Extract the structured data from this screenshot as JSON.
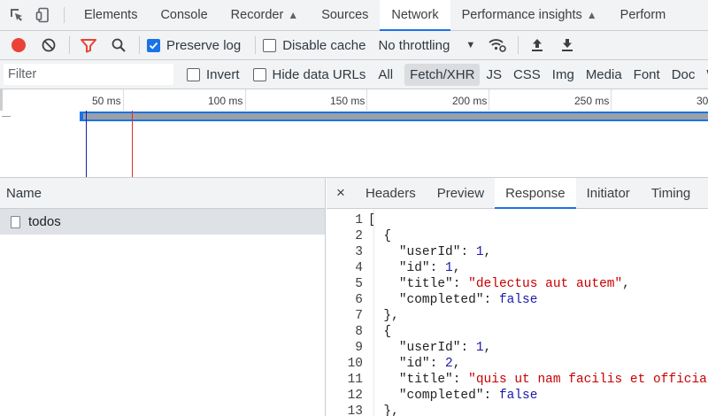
{
  "main_tabs": [
    {
      "label": "Elements"
    },
    {
      "label": "Console"
    },
    {
      "label": "Recorder"
    },
    {
      "label": "Sources"
    },
    {
      "label": "Network"
    },
    {
      "label": "Performance insights"
    },
    {
      "label": "Perform"
    }
  ],
  "active_main_tab": "Network",
  "toolbar": {
    "preserve_log_label": "Preserve log",
    "preserve_log_checked": true,
    "disable_cache_label": "Disable cache",
    "disable_cache_checked": false,
    "throttling_value": "No throttling"
  },
  "filter_bar": {
    "placeholder": "Filter",
    "invert_label": "Invert",
    "hide_data_urls_label": "Hide data URLs",
    "types": [
      {
        "label": "All"
      },
      {
        "label": "Fetch/XHR"
      },
      {
        "label": "JS"
      },
      {
        "label": "CSS"
      },
      {
        "label": "Img"
      },
      {
        "label": "Media"
      },
      {
        "label": "Font"
      },
      {
        "label": "Doc"
      },
      {
        "label": "W"
      }
    ],
    "active_type": "Fetch/XHR"
  },
  "timeline": {
    "ticks": [
      {
        "label": "50 ms"
      },
      {
        "label": "100 ms"
      },
      {
        "label": "150 ms"
      },
      {
        "label": "200 ms"
      },
      {
        "label": "250 ms"
      },
      {
        "label": "30"
      }
    ]
  },
  "request_list": {
    "column_header": "Name",
    "rows": [
      {
        "name": "todos",
        "selected": true
      }
    ]
  },
  "detail_panel": {
    "close_label": "×",
    "tabs": [
      {
        "label": "Headers"
      },
      {
        "label": "Preview"
      },
      {
        "label": "Response"
      },
      {
        "label": "Initiator"
      },
      {
        "label": "Timing"
      }
    ],
    "active_tab": "Response",
    "line_numbers": [
      "1",
      "2",
      "3",
      "4",
      "5",
      "6",
      "7",
      "8",
      "9",
      "10",
      "11",
      "12",
      "13"
    ],
    "lines": [
      {
        "indent": "",
        "text": "["
      },
      {
        "indent": "  ",
        "text": "{"
      },
      {
        "indent": "    ",
        "key": "\"userId\"",
        "value": "1",
        "vtype": "n",
        "comma": ","
      },
      {
        "indent": "    ",
        "key": "\"id\"",
        "value": "1",
        "vtype": "n",
        "comma": ","
      },
      {
        "indent": "    ",
        "key": "\"title\"",
        "value": "\"delectus aut autem\"",
        "vtype": "s",
        "comma": ","
      },
      {
        "indent": "    ",
        "key": "\"completed\"",
        "value": "false",
        "vtype": "b",
        "comma": ""
      },
      {
        "indent": "  ",
        "text": "},"
      },
      {
        "indent": "  ",
        "text": "{"
      },
      {
        "indent": "    ",
        "key": "\"userId\"",
        "value": "1",
        "vtype": "n",
        "comma": ","
      },
      {
        "indent": "    ",
        "key": "\"id\"",
        "value": "2",
        "vtype": "n",
        "comma": ","
      },
      {
        "indent": "    ",
        "key": "\"title\"",
        "value": "\"quis ut nam facilis et officia q",
        "vtype": "s",
        "comma": ""
      },
      {
        "indent": "    ",
        "key": "\"completed\"",
        "value": "false",
        "vtype": "b",
        "comma": ""
      },
      {
        "indent": "  ",
        "text": "},"
      }
    ]
  },
  "colors": {
    "accent": "#1a73e8",
    "record": "#ea4335",
    "filter_icon": "#ea4335",
    "string": "#c80000",
    "number": "#1a1aa6"
  }
}
